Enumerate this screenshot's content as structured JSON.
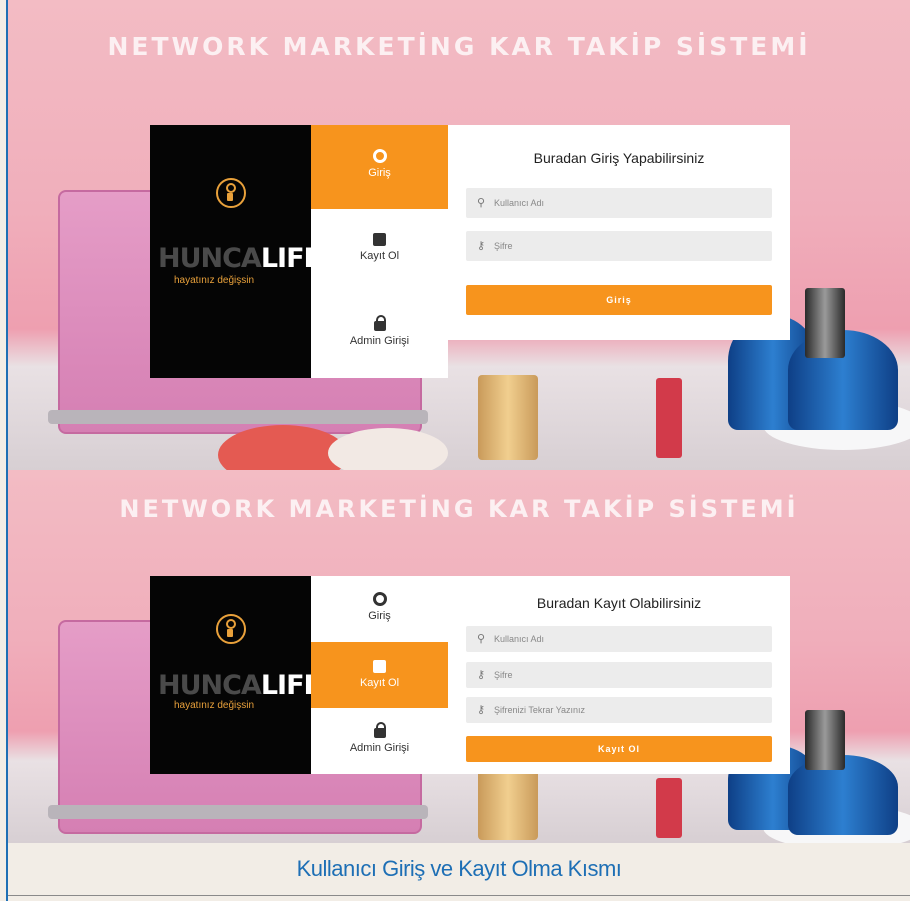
{
  "colors": {
    "accent": "#f7941d",
    "caption": "#1e6fb5",
    "brand_gold": "#e9a13b"
  },
  "screen1": {
    "title": "NETWORK MARKETİNG KAR TAKİP SİSTEMİ",
    "brand": {
      "part1": "HUNCA",
      "part2": "LIFE",
      "tagline": "hayatınız değişsin"
    },
    "menu": [
      {
        "label": "Giriş",
        "icon": "user-icon",
        "active": true
      },
      {
        "label": "Kayıt Ol",
        "icon": "edit-icon",
        "active": false
      },
      {
        "label": "Admin Girişi",
        "icon": "lock-icon",
        "active": false
      }
    ],
    "form": {
      "heading": "Buradan Giriş Yapabilirsiniz",
      "username_placeholder": "Kullanıcı Adı",
      "password_placeholder": "Şifre",
      "submit_label": "Giriş"
    }
  },
  "screen2": {
    "title": "NETWORK MARKETİNG KAR TAKİP SİSTEMİ",
    "brand": {
      "part1": "HUNCA",
      "part2": "LIFE",
      "tagline": "hayatınız değişsin"
    },
    "menu": [
      {
        "label": "Giriş",
        "icon": "user-icon",
        "active": false
      },
      {
        "label": "Kayıt Ol",
        "icon": "edit-icon",
        "active": true
      },
      {
        "label": "Admin Girişi",
        "icon": "lock-icon",
        "active": false
      }
    ],
    "form": {
      "heading": "Buradan Kayıt Olabilirsiniz",
      "username_placeholder": "Kullanıcı Adı",
      "password_placeholder": "Şifre",
      "password_repeat_placeholder": "Şifrenizi Tekrar Yazınız",
      "submit_label": "Kayıt Ol"
    }
  },
  "caption": "Kullanıcı Giriş ve Kayıt Olma Kısmı"
}
